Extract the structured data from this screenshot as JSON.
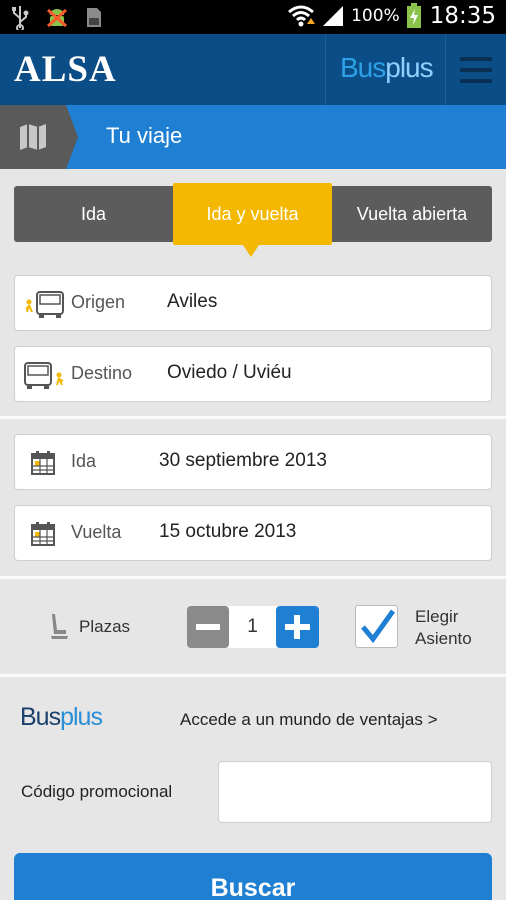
{
  "status_bar": {
    "battery_percent": "100%",
    "time": "18:35",
    "icons": [
      "usb-icon",
      "android-debug-icon",
      "sd-card-icon",
      "wifi-icon",
      "signal-icon",
      "battery-charging-icon"
    ]
  },
  "header": {
    "brand": "ALSA",
    "busplus_part1": "Bus",
    "busplus_part2": "plus",
    "menu_icon": "hamburger-menu-icon"
  },
  "title_bar": {
    "map_icon": "map-icon",
    "title": "Tu viaje"
  },
  "trip_type": {
    "options": [
      "Ida",
      "Ida y vuelta",
      "Vuelta abierta"
    ],
    "selected": "Ida y vuelta",
    "selected_color": "#f5b800"
  },
  "origin": {
    "label": "Origen",
    "value": "Aviles",
    "icon": "bus-departure-icon"
  },
  "destination": {
    "label": "Destino",
    "value": "Oviedo / Uviéu",
    "icon": "bus-arrival-icon"
  },
  "dates": {
    "outbound_label": "Ida",
    "outbound_value": "30 septiembre 2013",
    "return_label": "Vuelta",
    "return_value": "15 octubre 2013",
    "icon": "calendar-icon"
  },
  "seats": {
    "label": "Plazas",
    "count": "1",
    "icon": "seat-icon",
    "choose_seat_line1": "Elegir",
    "choose_seat_line2": "Asiento",
    "choose_seat_checked": true
  },
  "busplus_section": {
    "logo_part1": "Bus",
    "logo_part2": "plus",
    "link": "Accede a un mundo de ventajas >"
  },
  "promo": {
    "label": "Código promocional",
    "value": "",
    "placeholder": ""
  },
  "search_button": "Buscar",
  "colors": {
    "header_blue": "#0b4d87",
    "accent_blue": "#1f7fd2",
    "accent_yellow": "#f5b800"
  }
}
